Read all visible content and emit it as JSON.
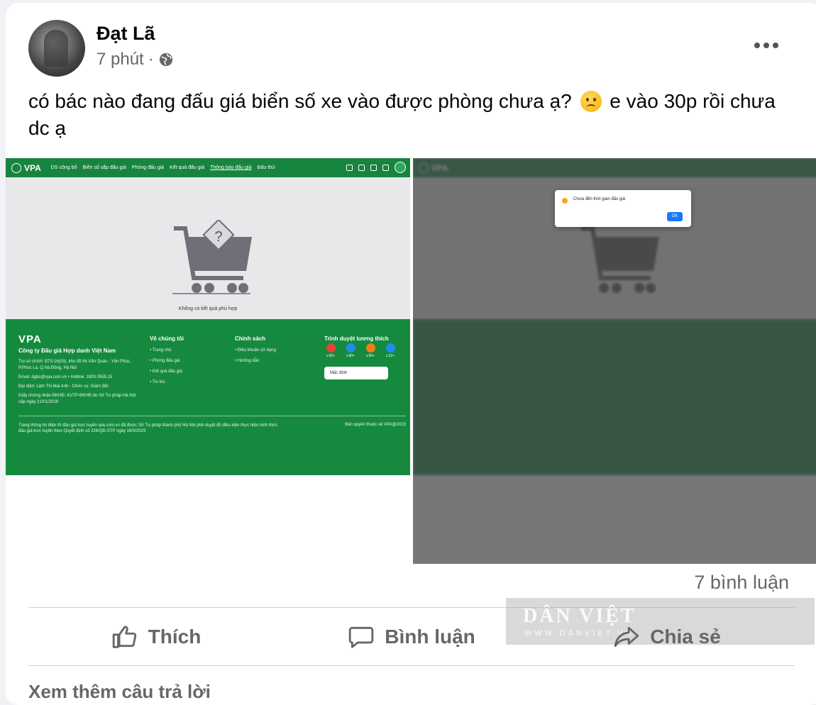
{
  "post": {
    "author": "Đạt Lã",
    "time": "7 phút",
    "separator": "·",
    "text_before_emoji": "có bác nào đang đấu giá biển số xe vào được phòng chưa ạ?",
    "text_after_emoji": "e vào 30p rồi chưa dc ạ",
    "emoji": "frowning-face",
    "comment_count": "7 bình luận"
  },
  "actions": {
    "like": "Thích",
    "comment": "Bình luận",
    "share": "Chia sẻ"
  },
  "more_replies": "Xem thêm câu trả lời",
  "screenshot": {
    "logo": "VPA",
    "nav": [
      "DS công bố",
      "Biển số sắp đấu giá",
      "Phòng đấu giá",
      "Kết quả đấu giá",
      "Thông báo đấu giá",
      "Đấu thử"
    ],
    "empty_message": "Không có kết quả phù hợp",
    "company": "Công ty Đấu giá Hợp danh Việt Nam",
    "address": "Trụ sở chính: BT5-16(03), khu đô thị Văn Quán - Yên Phúc, P.Phúc La, Q.Hà Đông, Hà Nội",
    "contact": "Email: dgbs@vpa.com.vn  •  Hotline: 1800.0555.15",
    "representative": "Đại diện: Lâm Thị Mai Anh - Chức vụ: Giám đốc",
    "license": "Giấy chứng nhận ĐKHĐ: 41/TP-ĐKHĐ do Sở Tư pháp Hà Nội cấp ngày 21/01/2019",
    "about_title": "Về chúng tôi",
    "about_items": [
      "Trang chủ",
      "Phòng đấu giá",
      "Kết quả đấu giá",
      "Tin tức"
    ],
    "policy_title": "Chính sách",
    "policy_items": [
      "Điều khoản sử dụng",
      "Hướng dẫn"
    ],
    "browser_title": "Trình duyệt tương thích",
    "browsers": [
      {
        "version": "v.90+",
        "color": "#e94235"
      },
      {
        "version": "v.90+",
        "color": "#1f8de0"
      },
      {
        "version": "v.90+",
        "color": "#f07d1a"
      },
      {
        "version": "v.12+",
        "color": "#1e8cf0"
      }
    ],
    "language_select": "Mặc định",
    "legal": "Trang thông tin điện tử đấu giá trực tuyến vpa.com.vn đã được Sở Tư pháp thành phố Hà Nội phê duyệt đủ điều kiện thực hiện hình thức đấu giá trực tuyến theo Quyết định số 226/QĐ-STP ngày 16/3/2023",
    "copyright": "Bản quyền thuộc về VPA@2023",
    "dialog_message": "Chưa đến thời gian đấu giá",
    "dialog_ok": "OK"
  },
  "watermark": {
    "title": "DÂN VIỆT",
    "subtitle": "WWW.DANVIET.VN"
  }
}
